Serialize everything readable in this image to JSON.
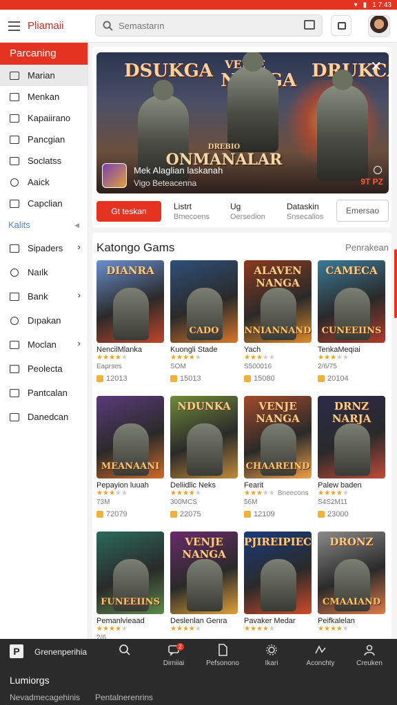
{
  "status": {
    "time": "",
    "right": "1 7:43"
  },
  "header": {
    "title": "Pliamaii",
    "search_placeholder": "Semastarın"
  },
  "sidebar": {
    "heading": "Parcaning",
    "items": [
      {
        "label": "Marian",
        "icon": "square-icon"
      },
      {
        "label": "Menkan",
        "icon": "book-icon"
      },
      {
        "label": "Kapaiirano",
        "icon": "mail-icon"
      },
      {
        "label": "Pancgian",
        "icon": "monitor-icon"
      },
      {
        "label": "Soclatss",
        "icon": "gift-icon"
      },
      {
        "label": "Aaick",
        "icon": "search-icon"
      },
      {
        "label": "Capclian",
        "icon": "chat-icon"
      }
    ],
    "section": "Kalits",
    "items2": [
      {
        "label": "Sipaders",
        "icon": "brush-icon",
        "chevron": true
      },
      {
        "label": "Naılk",
        "icon": "pin-icon",
        "chevron": false
      },
      {
        "label": "Bank",
        "icon": "check-box-icon",
        "chevron": true
      },
      {
        "label": "Dıpakan",
        "icon": "location-icon",
        "chevron": false
      },
      {
        "label": "Moclan",
        "icon": "columns-icon",
        "chevron": true
      },
      {
        "label": "Peolecta",
        "icon": "grid-icon",
        "chevron": false
      },
      {
        "label": "Pantcalan",
        "icon": "photo-icon",
        "chevron": false
      },
      {
        "label": "Danedcan",
        "icon": "camera-icon",
        "chevron": false
      }
    ]
  },
  "banner": {
    "logo_left": "DSUKGA",
    "logo_mid_top": "VENJE",
    "logo_mid": "NANGA",
    "logo_right": "DRUKCA",
    "center_small": "DREBIO",
    "center": "ONMANALAR",
    "line1": "Mek Alaglian laskanah",
    "line2": "Vigo Beteacenna",
    "price": "9T PZ"
  },
  "tabs": {
    "active": "Gt teskan",
    "items": [
      {
        "title": "Listrt",
        "sub": "Bmecoens"
      },
      {
        "title": "Ug",
        "sub": "Oersedion"
      },
      {
        "title": "Dataskin",
        "sub": "Snsecalios"
      }
    ],
    "outline": "Emersao"
  },
  "games": {
    "title": "Katongo Gams",
    "more": "Penrakean",
    "items": [
      {
        "logo": "DIANRA",
        "logo2": "",
        "name": "NencilMlanka",
        "rating": 4,
        "rating_text": "",
        "sub": "Eaprses",
        "downloads": "12013",
        "c1": "#6a8fd0",
        "c2": "#c0452a"
      },
      {
        "logo": "",
        "logo2": "CADO",
        "name": "Kuongli Stade",
        "rating": 4,
        "rating_text": "",
        "sub": "SOM",
        "downloads": "15013",
        "c1": "#2f4f7a",
        "c2": "#d9762a"
      },
      {
        "logo": "ALAVEN NANGA",
        "logo2": "NNIANNAND",
        "name": "Yach",
        "rating": 3,
        "rating_text": "",
        "sub": "S500016",
        "downloads": "15080",
        "c1": "#8a3a1e",
        "c2": "#e08a2a"
      },
      {
        "logo": "CAMECA",
        "logo2": "CUNEEIINS",
        "name": "TenkaMeqiai",
        "rating": 3,
        "rating_text": "",
        "sub": "2/6/75",
        "downloads": "20104",
        "c1": "#3a7a9a",
        "c2": "#b03a2a"
      },
      {
        "logo": "",
        "logo2": "MEANAANI",
        "name": "Pepayion luuah",
        "rating": 3,
        "rating_text": "",
        "sub": "73M",
        "downloads": "72079",
        "c1": "#5a3a7a",
        "c2": "#d06a2a"
      },
      {
        "logo": "NDUNKA",
        "logo2": "",
        "name": "Deliidlic Neks",
        "rating": 4,
        "rating_text": "",
        "sub": "300MCS",
        "downloads": "22075",
        "c1": "#6f8a3a",
        "c2": "#c08a3a"
      },
      {
        "logo": "VENJE NANGA",
        "logo2": "CHAAREIND",
        "name": "Fearit",
        "rating": 3,
        "rating_text": "Bneecons",
        "sub": "56M",
        "downloads": "12109",
        "c1": "#a04a2a",
        "c2": "#f0a04a"
      },
      {
        "logo": "DRNZ NARJA",
        "logo2": "",
        "name": "Palew baden",
        "rating": 4,
        "rating_text": "",
        "sub": "S4S2M11",
        "downloads": "23000",
        "c1": "#2a2a4a",
        "c2": "#c04a3a"
      },
      {
        "logo": "",
        "logo2": "FUNEEIINS",
        "name": "Pemanlvieaad",
        "rating": 4,
        "rating_text": "",
        "sub": "2/6",
        "downloads": "",
        "c1": "#2a6a5a",
        "c2": "#5a8a4a"
      },
      {
        "logo": "VENJE NANGA",
        "logo2": "",
        "name": "Deslenlan Genra",
        "rating": 4,
        "rating_text": "",
        "sub": "",
        "downloads": "",
        "c1": "#6a2a6a",
        "c2": "#e0a03a"
      },
      {
        "logo": "PJIREIPIECES",
        "logo2": "",
        "name": "Pavaker Medar",
        "rating": 4,
        "rating_text": "",
        "sub": "",
        "downloads": "",
        "c1": "#1a3a7a",
        "c2": "#d04a2a"
      },
      {
        "logo": "DRONZ",
        "logo2": "CMAAIAND",
        "name": "Peifkalelan",
        "rating": 4,
        "rating_text": "",
        "sub": "",
        "downloads": "",
        "c1": "#8a8a8a",
        "c2": "#e07a4a"
      }
    ]
  },
  "bottom": {
    "brand": "Grenenperihia",
    "nav": [
      {
        "label": "",
        "icon": "search-icon"
      },
      {
        "label": "Dirniiai",
        "icon": "chat-bubble-icon",
        "badge": "2"
      },
      {
        "label": "Pefsonono",
        "icon": "document-icon"
      },
      {
        "label": "Ikari",
        "icon": "gear-icon"
      },
      {
        "label": "Aconchty",
        "icon": "activity-icon"
      },
      {
        "label": "Creuken",
        "icon": "person-icon"
      }
    ],
    "title": "Lumiorgs",
    "sub1": "Nevadmecagehinis",
    "sub2": "Pentalnerenrins"
  },
  "colors": {
    "accent": "#e53322",
    "bottom_bg": "#2b2b2b"
  }
}
